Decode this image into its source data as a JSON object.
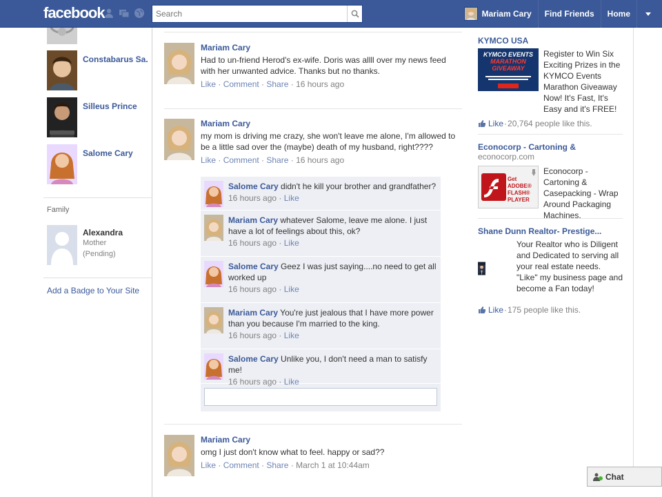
{
  "header": {
    "logo": "facebook",
    "search_placeholder": "Search",
    "user_name": "Mariam Cary",
    "find_friends": "Find Friends",
    "home": "Home"
  },
  "left": {
    "friends": [
      {
        "name": "Constabarus Sa..."
      },
      {
        "name": "Silleus Prince"
      },
      {
        "name": "Salome Cary"
      }
    ],
    "family_label": "Family",
    "family": {
      "name": "Alexandra",
      "relation": "Mother",
      "status": "(Pending)"
    },
    "badge_link": "Add a Badge to Your Site"
  },
  "feed": {
    "posts": [
      {
        "author": "Mariam Cary",
        "text": "Had to un-friend Herod's ex-wife. Doris was allll over my news feed with her unwanted advice. Thanks but no thanks.",
        "like": "Like",
        "comment": "Comment",
        "share": "Share",
        "time": "16 hours ago"
      },
      {
        "author": "Mariam Cary",
        "text": "my mom is driving me crazy, she won't leave me alone, I'm allowed to be a little sad over the (maybe) death of my husband, right????",
        "like": "Like",
        "comment": "Comment",
        "share": "Share",
        "time": "16 hours ago"
      },
      {
        "author": "Mariam Cary",
        "text": "omg I just don't know what to feel. happy or sad??",
        "like": "Like",
        "comment": "Comment",
        "share": "Share",
        "time": "March 1 at 10:44am"
      }
    ],
    "comments": [
      {
        "author": "Salome Cary",
        "text": "didn't he kill your brother and grandfather?",
        "time": "16 hours ago",
        "like": "Like"
      },
      {
        "author": "Mariam Cary",
        "text": "whatever Salome, leave me alone. I just have a lot of feelings about this, ok?",
        "time": "16 hours ago",
        "like": "Like"
      },
      {
        "author": "Salome Cary",
        "text": "Geez I was just saying....no need to get all worked up",
        "time": "16 hours ago",
        "like": "Like"
      },
      {
        "author": "Mariam Cary",
        "text": "You're just jealous that I have more power than you because I'm married to the king.",
        "time": "16 hours ago",
        "like": "Like"
      },
      {
        "author": "Salome Cary",
        "text": "Unlike you, I don't need a man to satisfy me!",
        "time": "16 hours ago",
        "like": "Like"
      }
    ]
  },
  "ads": [
    {
      "title": "KYMCO USA",
      "domain": "",
      "img_title": "KYMCO EVENTS",
      "img_subtitle": "MARATHON GIVEAWAY",
      "text": "Register to Win Six Exciting Prizes in the KYMCO Events Marathon Giveaway Now! It's Fast, It's Easy and it's FREE!",
      "like": "Like",
      "count": "20,764 people like this."
    },
    {
      "title": "Econocorp - Cartoning &",
      "domain": "econocorp.com",
      "img_title": "Get ADOBE® FLASH® PLAYER",
      "text": "Econocorp - Cartoning & Casepacking - Wrap Around Packaging Machines."
    },
    {
      "title": "Shane Dunn Realtor- Prestige...",
      "domain": "",
      "text": "Your Realtor who is Diligent and Dedicated to serving all your real estate needs. \"Like\" my business page and become a Fan today!",
      "like": "Like",
      "count": "175 people like this."
    }
  ],
  "chat": {
    "label": "Chat"
  },
  "colors": {
    "brand": "#3b5998",
    "link": "#3b5998",
    "muted": "#808080",
    "comment_bg": "#edeff4"
  }
}
